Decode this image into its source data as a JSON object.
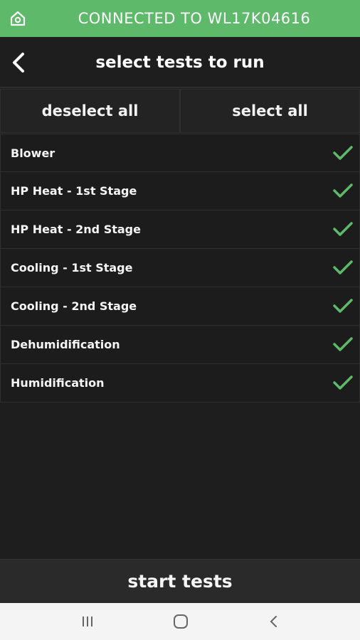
{
  "status": {
    "connection_text": "CONNECTED TO WL17K04616",
    "home_icon": "home-icon",
    "accent_color": "#5fb96a"
  },
  "header": {
    "title": "select tests to run",
    "back_icon": "chevron-left-icon"
  },
  "selection": {
    "deselect_label": "deselect all",
    "select_label": "select all"
  },
  "tests": [
    {
      "label": "Blower",
      "checked": true
    },
    {
      "label": "HP Heat - 1st Stage",
      "checked": true
    },
    {
      "label": "HP Heat - 2nd Stage",
      "checked": true
    },
    {
      "label": "Cooling - 1st Stage",
      "checked": true
    },
    {
      "label": "Cooling - 2nd Stage",
      "checked": true
    },
    {
      "label": "Dehumidification",
      "checked": true
    },
    {
      "label": "Humidification",
      "checked": true
    }
  ],
  "footer": {
    "start_label": "start tests"
  },
  "system_nav": {
    "recents_icon": "recents-icon",
    "home_icon": "home-circle-icon",
    "back_icon": "back-chevron-icon"
  }
}
